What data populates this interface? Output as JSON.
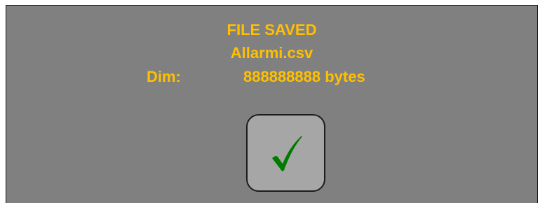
{
  "colors": {
    "background": "#808080",
    "message_text": "#FFC000",
    "checkmark": "#007A00",
    "button_face": "#A6A6A6"
  },
  "dialog": {
    "title": "FILE SAVED",
    "file_name": "Allarmi.csv",
    "size_label": "Dim:",
    "size_value": "888888888 bytes"
  },
  "confirm_button": {
    "icon": "checkmark-icon"
  }
}
